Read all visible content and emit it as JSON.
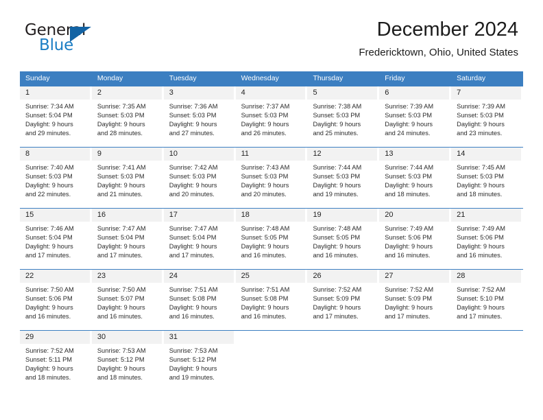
{
  "brand": {
    "name_top": "General",
    "name_bottom": "Blue"
  },
  "header": {
    "title": "December 2024",
    "location": "Fredericktown, Ohio, United States"
  },
  "colors": {
    "header_blue": "#3c7fc1",
    "day_band_gray": "#f2f2f2",
    "brand_blue": "#1a7dc4",
    "brand_dark": "#231f20"
  },
  "weekdays": [
    "Sunday",
    "Monday",
    "Tuesday",
    "Wednesday",
    "Thursday",
    "Friday",
    "Saturday"
  ],
  "weeks": [
    [
      {
        "day": "1",
        "sunrise": "Sunrise: 7:34 AM",
        "sunset": "Sunset: 5:04 PM",
        "daylight1": "Daylight: 9 hours",
        "daylight2": "and 29 minutes."
      },
      {
        "day": "2",
        "sunrise": "Sunrise: 7:35 AM",
        "sunset": "Sunset: 5:03 PM",
        "daylight1": "Daylight: 9 hours",
        "daylight2": "and 28 minutes."
      },
      {
        "day": "3",
        "sunrise": "Sunrise: 7:36 AM",
        "sunset": "Sunset: 5:03 PM",
        "daylight1": "Daylight: 9 hours",
        "daylight2": "and 27 minutes."
      },
      {
        "day": "4",
        "sunrise": "Sunrise: 7:37 AM",
        "sunset": "Sunset: 5:03 PM",
        "daylight1": "Daylight: 9 hours",
        "daylight2": "and 26 minutes."
      },
      {
        "day": "5",
        "sunrise": "Sunrise: 7:38 AM",
        "sunset": "Sunset: 5:03 PM",
        "daylight1": "Daylight: 9 hours",
        "daylight2": "and 25 minutes."
      },
      {
        "day": "6",
        "sunrise": "Sunrise: 7:39 AM",
        "sunset": "Sunset: 5:03 PM",
        "daylight1": "Daylight: 9 hours",
        "daylight2": "and 24 minutes."
      },
      {
        "day": "7",
        "sunrise": "Sunrise: 7:39 AM",
        "sunset": "Sunset: 5:03 PM",
        "daylight1": "Daylight: 9 hours",
        "daylight2": "and 23 minutes."
      }
    ],
    [
      {
        "day": "8",
        "sunrise": "Sunrise: 7:40 AM",
        "sunset": "Sunset: 5:03 PM",
        "daylight1": "Daylight: 9 hours",
        "daylight2": "and 22 minutes."
      },
      {
        "day": "9",
        "sunrise": "Sunrise: 7:41 AM",
        "sunset": "Sunset: 5:03 PM",
        "daylight1": "Daylight: 9 hours",
        "daylight2": "and 21 minutes."
      },
      {
        "day": "10",
        "sunrise": "Sunrise: 7:42 AM",
        "sunset": "Sunset: 5:03 PM",
        "daylight1": "Daylight: 9 hours",
        "daylight2": "and 20 minutes."
      },
      {
        "day": "11",
        "sunrise": "Sunrise: 7:43 AM",
        "sunset": "Sunset: 5:03 PM",
        "daylight1": "Daylight: 9 hours",
        "daylight2": "and 20 minutes."
      },
      {
        "day": "12",
        "sunrise": "Sunrise: 7:44 AM",
        "sunset": "Sunset: 5:03 PM",
        "daylight1": "Daylight: 9 hours",
        "daylight2": "and 19 minutes."
      },
      {
        "day": "13",
        "sunrise": "Sunrise: 7:44 AM",
        "sunset": "Sunset: 5:03 PM",
        "daylight1": "Daylight: 9 hours",
        "daylight2": "and 18 minutes."
      },
      {
        "day": "14",
        "sunrise": "Sunrise: 7:45 AM",
        "sunset": "Sunset: 5:03 PM",
        "daylight1": "Daylight: 9 hours",
        "daylight2": "and 18 minutes."
      }
    ],
    [
      {
        "day": "15",
        "sunrise": "Sunrise: 7:46 AM",
        "sunset": "Sunset: 5:04 PM",
        "daylight1": "Daylight: 9 hours",
        "daylight2": "and 17 minutes."
      },
      {
        "day": "16",
        "sunrise": "Sunrise: 7:47 AM",
        "sunset": "Sunset: 5:04 PM",
        "daylight1": "Daylight: 9 hours",
        "daylight2": "and 17 minutes."
      },
      {
        "day": "17",
        "sunrise": "Sunrise: 7:47 AM",
        "sunset": "Sunset: 5:04 PM",
        "daylight1": "Daylight: 9 hours",
        "daylight2": "and 17 minutes."
      },
      {
        "day": "18",
        "sunrise": "Sunrise: 7:48 AM",
        "sunset": "Sunset: 5:05 PM",
        "daylight1": "Daylight: 9 hours",
        "daylight2": "and 16 minutes."
      },
      {
        "day": "19",
        "sunrise": "Sunrise: 7:48 AM",
        "sunset": "Sunset: 5:05 PM",
        "daylight1": "Daylight: 9 hours",
        "daylight2": "and 16 minutes."
      },
      {
        "day": "20",
        "sunrise": "Sunrise: 7:49 AM",
        "sunset": "Sunset: 5:06 PM",
        "daylight1": "Daylight: 9 hours",
        "daylight2": "and 16 minutes."
      },
      {
        "day": "21",
        "sunrise": "Sunrise: 7:49 AM",
        "sunset": "Sunset: 5:06 PM",
        "daylight1": "Daylight: 9 hours",
        "daylight2": "and 16 minutes."
      }
    ],
    [
      {
        "day": "22",
        "sunrise": "Sunrise: 7:50 AM",
        "sunset": "Sunset: 5:06 PM",
        "daylight1": "Daylight: 9 hours",
        "daylight2": "and 16 minutes."
      },
      {
        "day": "23",
        "sunrise": "Sunrise: 7:50 AM",
        "sunset": "Sunset: 5:07 PM",
        "daylight1": "Daylight: 9 hours",
        "daylight2": "and 16 minutes."
      },
      {
        "day": "24",
        "sunrise": "Sunrise: 7:51 AM",
        "sunset": "Sunset: 5:08 PM",
        "daylight1": "Daylight: 9 hours",
        "daylight2": "and 16 minutes."
      },
      {
        "day": "25",
        "sunrise": "Sunrise: 7:51 AM",
        "sunset": "Sunset: 5:08 PM",
        "daylight1": "Daylight: 9 hours",
        "daylight2": "and 16 minutes."
      },
      {
        "day": "26",
        "sunrise": "Sunrise: 7:52 AM",
        "sunset": "Sunset: 5:09 PM",
        "daylight1": "Daylight: 9 hours",
        "daylight2": "and 17 minutes."
      },
      {
        "day": "27",
        "sunrise": "Sunrise: 7:52 AM",
        "sunset": "Sunset: 5:09 PM",
        "daylight1": "Daylight: 9 hours",
        "daylight2": "and 17 minutes."
      },
      {
        "day": "28",
        "sunrise": "Sunrise: 7:52 AM",
        "sunset": "Sunset: 5:10 PM",
        "daylight1": "Daylight: 9 hours",
        "daylight2": "and 17 minutes."
      }
    ],
    [
      {
        "day": "29",
        "sunrise": "Sunrise: 7:52 AM",
        "sunset": "Sunset: 5:11 PM",
        "daylight1": "Daylight: 9 hours",
        "daylight2": "and 18 minutes."
      },
      {
        "day": "30",
        "sunrise": "Sunrise: 7:53 AM",
        "sunset": "Sunset: 5:12 PM",
        "daylight1": "Daylight: 9 hours",
        "daylight2": "and 18 minutes."
      },
      {
        "day": "31",
        "sunrise": "Sunrise: 7:53 AM",
        "sunset": "Sunset: 5:12 PM",
        "daylight1": "Daylight: 9 hours",
        "daylight2": "and 19 minutes."
      },
      {
        "day": "",
        "sunrise": "",
        "sunset": "",
        "daylight1": "",
        "daylight2": ""
      },
      {
        "day": "",
        "sunrise": "",
        "sunset": "",
        "daylight1": "",
        "daylight2": ""
      },
      {
        "day": "",
        "sunrise": "",
        "sunset": "",
        "daylight1": "",
        "daylight2": ""
      },
      {
        "day": "",
        "sunrise": "",
        "sunset": "",
        "daylight1": "",
        "daylight2": ""
      }
    ]
  ]
}
